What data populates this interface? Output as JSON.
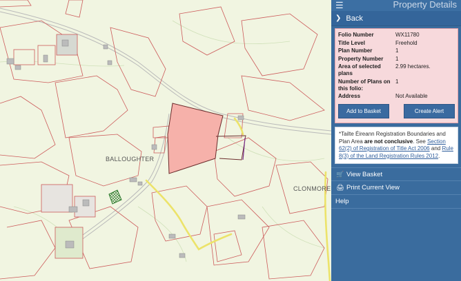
{
  "panel": {
    "title": "Property Details",
    "back_label": "Back",
    "details": [
      {
        "label": "Folio Number",
        "value": "WX11780"
      },
      {
        "label": "Title Level",
        "value": "Freehold"
      },
      {
        "label": "Plan Number",
        "value": "1"
      },
      {
        "label": "Property Number",
        "value": "1"
      },
      {
        "label": "Area of selected plans",
        "value": "2.99 hectares."
      },
      {
        "label": "Number of Plans on this folio:",
        "value": "1"
      },
      {
        "label": "Address",
        "value": "Not Available"
      }
    ],
    "add_basket_label": "Add to Basket",
    "create_alert_label": "Create Alert",
    "disclaimer": {
      "pre": "*Tailte Éireann Registration Boundaries and Plan Area ",
      "bold": "are not conclusive",
      "mid": ". See ",
      "link1": "Section 62(2) of Registration of Title Act 2006",
      "and": " and ",
      "link2": "Rule 8(3) of the Land Registration Rules 2012",
      "end": "."
    },
    "nav": [
      {
        "label": "View Basket",
        "icon": "cart-icon"
      },
      {
        "label": "Print Current View",
        "icon": "print-icon"
      },
      {
        "label": "Help",
        "icon": ""
      }
    ]
  },
  "map": {
    "labels": {
      "townland_1": "BALLOUGHTER",
      "townland_2": "CLONMORE"
    },
    "colors": {
      "background": "#f1f5e1",
      "boundary": "#cc5a5a",
      "selected_fill": "#f6b1aa",
      "road": "#ece36a",
      "building": "#bbbbbb"
    }
  }
}
